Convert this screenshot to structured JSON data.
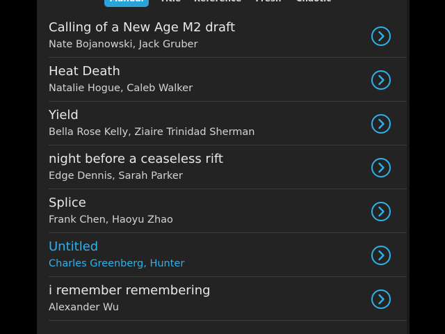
{
  "tabs": [
    {
      "label": "Manual",
      "active": true
    },
    {
      "label": "Title",
      "active": false
    },
    {
      "label": "Reference",
      "active": false
    },
    {
      "label": "Fresh",
      "active": false
    },
    {
      "label": "Chaotic",
      "active": false
    }
  ],
  "items": [
    {
      "title": "Calling of a New Age M2 draft",
      "authors": "Nate Bojanowski, Jack Gruber",
      "selected": false
    },
    {
      "title": "Heat Death",
      "authors": "Natalie Hogue, Caleb Walker",
      "selected": false
    },
    {
      "title": "Yield",
      "authors": "Bella Rose Kelly, Ziaire Trinidad Sherman",
      "selected": false
    },
    {
      "title": "night before a ceaseless rift",
      "authors": "Edge Dennis, Sarah Parker",
      "selected": false
    },
    {
      "title": "Splice",
      "authors": "Frank Chen, Haoyu Zhao",
      "selected": false
    },
    {
      "title": "Untitled",
      "authors": "Charles Greenberg, Hunter",
      "selected": true
    },
    {
      "title": "i remember remembering",
      "authors": "Alexander Wu",
      "selected": false
    }
  ],
  "colors": {
    "accent": "#2fb2ea",
    "panel_bg": "#232323",
    "chevron": "#2fb2ea"
  },
  "icons": {
    "row_action": "chevron-right-circle-icon"
  }
}
